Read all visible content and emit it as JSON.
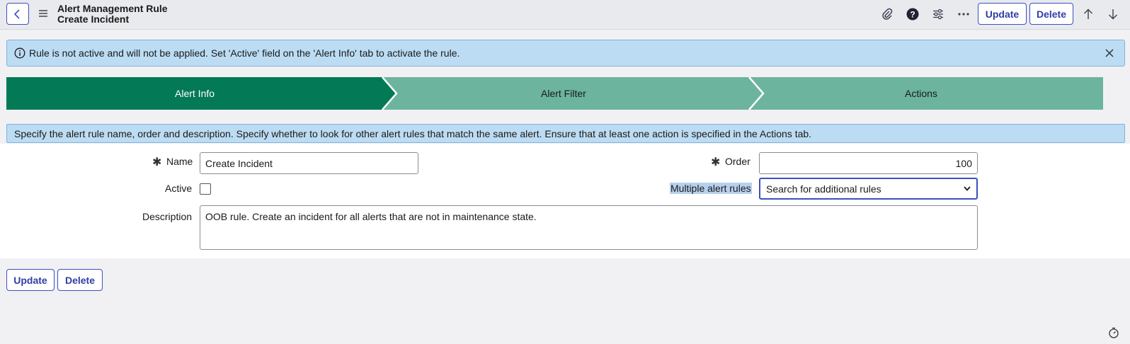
{
  "header": {
    "title_line1": "Alert Management Rule",
    "title_line2": "Create Incident",
    "update_label": "Update",
    "delete_label": "Delete",
    "icons": [
      "back-icon",
      "menu-icon",
      "paperclip-icon",
      "help-icon",
      "settings-sliders-icon",
      "more-icon",
      "arrow-up-icon",
      "arrow-down-icon"
    ]
  },
  "banner": {
    "message": "Rule is not active and will not be applied. Set 'Active' field on the 'Alert Info' tab to activate the rule."
  },
  "steps": [
    {
      "label": "Alert Info",
      "active": true
    },
    {
      "label": "Alert Filter",
      "active": false
    },
    {
      "label": "Actions",
      "active": false
    }
  ],
  "hint": {
    "message": "Specify the alert rule name, order and description. Specify whether to look for other alert rules that match the same alert. Ensure that at least one action is specified in the Actions tab."
  },
  "form": {
    "name_label": "Name",
    "name_value": "Create Incident",
    "order_label": "Order",
    "order_value": "100",
    "active_label": "Active",
    "active_checked": false,
    "multiple_label": "Multiple alert rules",
    "multiple_value": "Search for additional rules",
    "description_label": "Description",
    "description_value": "OOB rule. Create an incident for all alerts that are not in maintenance state."
  },
  "footer": {
    "update_label": "Update",
    "delete_label": "Delete"
  },
  "colors": {
    "accent": "#3c4fc0",
    "step_active": "#037a55",
    "step_inactive": "#6cb49e",
    "banner_bg": "#bcdcf3"
  }
}
